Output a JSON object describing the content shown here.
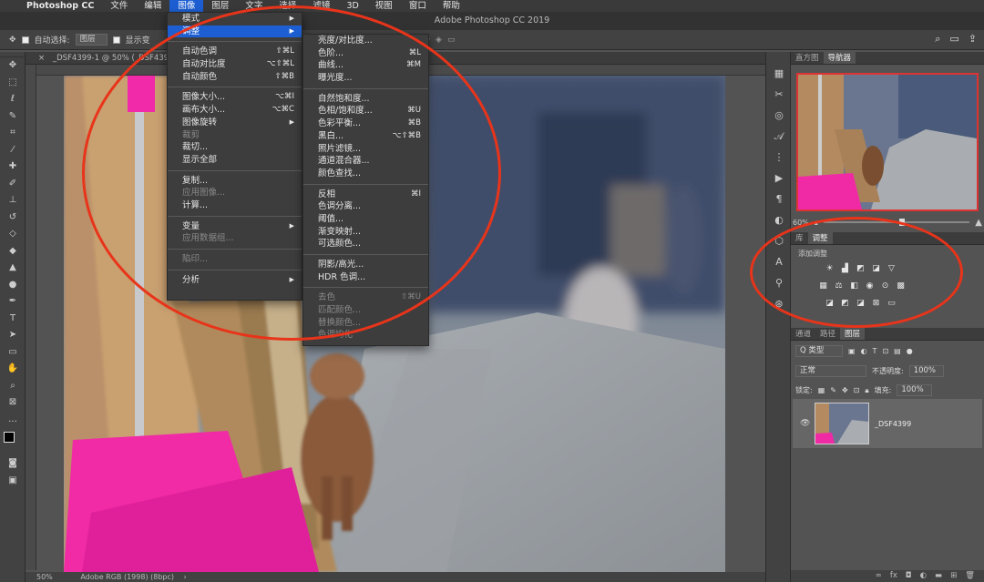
{
  "menubar": {
    "apple_icon": "apple-logo",
    "items": [
      "Photoshop CC",
      "文件",
      "编辑",
      "图像",
      "图层",
      "文字",
      "选择",
      "滤镜",
      "3D",
      "视图",
      "窗口",
      "帮助"
    ],
    "active_index": 3
  },
  "window": {
    "title": "Adobe Photoshop CC 2019"
  },
  "options_bar": {
    "auto_select_label": "自动选择:",
    "auto_select_value": "图层",
    "show_transform_label": "显示变"
  },
  "document": {
    "tab_title": "_DSF4399-1 @ 50% (_DSF4399, R",
    "zoom": "50%",
    "color_profile": "Adobe RGB (1998) (8bpc)"
  },
  "image_menu": {
    "items": [
      {
        "label": "模式",
        "shortcut": "",
        "submenu": true,
        "disabled": false
      },
      {
        "label": "调整",
        "shortcut": "",
        "submenu": true,
        "disabled": false,
        "highlighted": true
      },
      {
        "sep": true
      },
      {
        "label": "自动色调",
        "shortcut": "⇧⌘L"
      },
      {
        "label": "自动对比度",
        "shortcut": "⌥⇧⌘L"
      },
      {
        "label": "自动颜色",
        "shortcut": "⇧⌘B"
      },
      {
        "sep": true
      },
      {
        "label": "图像大小...",
        "shortcut": "⌥⌘I"
      },
      {
        "label": "画布大小...",
        "shortcut": "⌥⌘C"
      },
      {
        "label": "图像旋转",
        "shortcut": "",
        "submenu": true
      },
      {
        "label": "裁剪",
        "shortcut": "",
        "disabled": true
      },
      {
        "label": "裁切...",
        "shortcut": ""
      },
      {
        "label": "显示全部",
        "shortcut": ""
      },
      {
        "sep": true
      },
      {
        "label": "复制...",
        "shortcut": ""
      },
      {
        "label": "应用图像...",
        "shortcut": "",
        "disabled": true
      },
      {
        "label": "计算...",
        "shortcut": ""
      },
      {
        "sep": true
      },
      {
        "label": "变量",
        "shortcut": "",
        "submenu": true
      },
      {
        "label": "应用数据组...",
        "shortcut": "",
        "disabled": true
      },
      {
        "sep": true
      },
      {
        "label": "陷印...",
        "shortcut": "",
        "disabled": true
      },
      {
        "sep": true
      },
      {
        "label": "分析",
        "shortcut": "",
        "submenu": true
      }
    ]
  },
  "adjust_submenu": {
    "items": [
      {
        "label": "亮度/对比度...",
        "shortcut": ""
      },
      {
        "label": "色阶...",
        "shortcut": "⌘L"
      },
      {
        "label": "曲线...",
        "shortcut": "⌘M"
      },
      {
        "label": "曝光度...",
        "shortcut": ""
      },
      {
        "sep": true
      },
      {
        "label": "自然饱和度...",
        "shortcut": ""
      },
      {
        "label": "色相/饱和度...",
        "shortcut": "⌘U"
      },
      {
        "label": "色彩平衡...",
        "shortcut": "⌘B"
      },
      {
        "label": "黑白...",
        "shortcut": "⌥⇧⌘B"
      },
      {
        "label": "照片滤镜...",
        "shortcut": ""
      },
      {
        "label": "通道混合器...",
        "shortcut": ""
      },
      {
        "label": "颜色查找...",
        "shortcut": ""
      },
      {
        "sep": true
      },
      {
        "label": "反相",
        "shortcut": "⌘I"
      },
      {
        "label": "色调分离...",
        "shortcut": ""
      },
      {
        "label": "阈值...",
        "shortcut": ""
      },
      {
        "label": "渐变映射...",
        "shortcut": ""
      },
      {
        "label": "可选颜色...",
        "shortcut": ""
      },
      {
        "sep": true
      },
      {
        "label": "阴影/高光...",
        "shortcut": ""
      },
      {
        "label": "HDR 色调...",
        "shortcut": ""
      },
      {
        "sep": true
      },
      {
        "label": "去色",
        "shortcut": "⇧⌘U",
        "disabled": true
      },
      {
        "label": "匹配颜色...",
        "shortcut": "",
        "disabled": true
      },
      {
        "label": "替换颜色...",
        "shortcut": "",
        "disabled": true
      },
      {
        "label": "色调均化",
        "shortcut": "",
        "disabled": true
      }
    ]
  },
  "navigator_panel": {
    "tabs": [
      "直方图",
      "导航器"
    ],
    "zoom": "60%"
  },
  "adjustments_panel": {
    "tabs": [
      "库",
      "调整"
    ],
    "title": "添加调整"
  },
  "layers_panel": {
    "tabs": [
      "通道",
      "路径",
      "图层"
    ],
    "filter_label": "Q 类型",
    "blend_mode": "正常",
    "opacity_label": "不透明度:",
    "opacity_value": "100%",
    "lock_label": "锁定:",
    "fill_label": "填充:",
    "fill_value": "100%",
    "layer_name": "_DSF4399",
    "bottom_icons": [
      "link-icon",
      "fx-icon",
      "mask-icon",
      "adjustment-icon",
      "folder-icon",
      "new-layer-icon",
      "trash-icon"
    ]
  },
  "annotations": {
    "color": "#e8341a"
  }
}
